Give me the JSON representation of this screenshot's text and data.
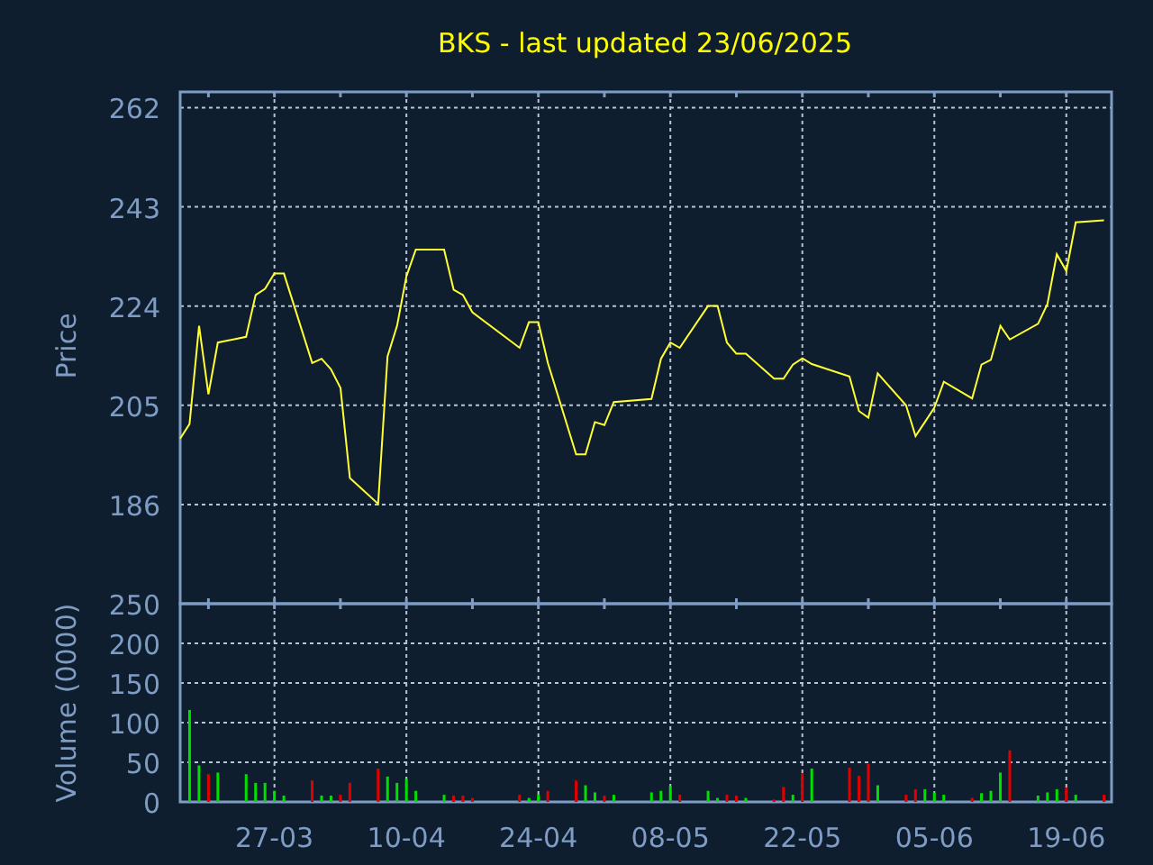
{
  "title": "BKS - last updated 23/06/2025",
  "price_panel": {
    "chart_data": {
      "type": "line",
      "ylabel": "Price",
      "categories": [
        null,
        null,
        null,
        null,
        null,
        null,
        null,
        null,
        null,
        null,
        null,
        null,
        null,
        null,
        null,
        null,
        null,
        null,
        null,
        null,
        null,
        null,
        null,
        null,
        null,
        null,
        null,
        null,
        null,
        null,
        null,
        null,
        null,
        null,
        null,
        null,
        null,
        null,
        null,
        null,
        null,
        null,
        null,
        null,
        null,
        null,
        null,
        null,
        null,
        null,
        null,
        null,
        null,
        null,
        null,
        null,
        null,
        null,
        null,
        null,
        null,
        null,
        null,
        null,
        null,
        null,
        null,
        null,
        null,
        null,
        null,
        null,
        null,
        null,
        null,
        null,
        null,
        null,
        null,
        null,
        null,
        null,
        null,
        null,
        null,
        null,
        null,
        null,
        null,
        null,
        null,
        null,
        null,
        null,
        null,
        null,
        null,
        null,
        null
      ],
      "series": [
        {
          "color": "#ffff33",
          "values": [
            198.6,
            201.4,
            220.2,
            207.1,
            217.0,
            null,
            null,
            218.1,
            226.1,
            227.3,
            230.2,
            230.2,
            null,
            null,
            213.1,
            213.9,
            211.9,
            208.3,
            191.1,
            null,
            null,
            186.1,
            214.3,
            220.2,
            229.7,
            234.8,
            null,
            null,
            234.8,
            227.1,
            226.1,
            222.8,
            null,
            null,
            null,
            null,
            216.0,
            220.9,
            220.9,
            213.1,
            null,
            null,
            195.6,
            195.6,
            201.8,
            201.2,
            205.6,
            null,
            null,
            null,
            206.2,
            213.9,
            217.0,
            216.0,
            null,
            null,
            224.0,
            224.0,
            217.0,
            214.9,
            214.9,
            null,
            null,
            210.1,
            210.1,
            212.8,
            214.0,
            212.9,
            null,
            null,
            null,
            210.5,
            203.9,
            202.6,
            211.1,
            null,
            null,
            205.0,
            199.1,
            201.8,
            204.5,
            209.5,
            null,
            null,
            206.3,
            212.8,
            213.7,
            220.2,
            217.6,
            null,
            null,
            220.6,
            224.4,
            233.9,
            230.7,
            240.0,
            null,
            null,
            240.4
          ]
        }
      ],
      "grid": true,
      "ylim": [
        167,
        265
      ],
      "yticks": [
        186,
        205,
        224,
        243,
        262
      ]
    }
  },
  "volume_panel": {
    "chart_data": {
      "type": "bar",
      "ylabel": "Volume (0000)",
      "categories": [
        null,
        null,
        null,
        null,
        null,
        null,
        null,
        null,
        null,
        null,
        "27-03",
        null,
        null,
        null,
        null,
        null,
        null,
        null,
        null,
        null,
        null,
        null,
        null,
        null,
        "10-04",
        null,
        null,
        null,
        null,
        null,
        null,
        null,
        null,
        null,
        null,
        null,
        null,
        null,
        "24-04",
        null,
        null,
        null,
        null,
        null,
        null,
        null,
        null,
        null,
        null,
        null,
        null,
        null,
        "08-05",
        null,
        null,
        null,
        null,
        null,
        null,
        null,
        null,
        null,
        null,
        null,
        null,
        null,
        "22-05",
        null,
        null,
        null,
        null,
        null,
        null,
        null,
        null,
        null,
        null,
        null,
        null,
        null,
        "05-06",
        null,
        null,
        null,
        null,
        null,
        null,
        null,
        null,
        null,
        null,
        null,
        null,
        null,
        "19-06",
        null,
        null,
        null,
        null
      ],
      "series": [
        {
          "color": "#00e000",
          "values": [
            null,
            116,
            46,
            null,
            37,
            null,
            null,
            35,
            24,
            24,
            14,
            8,
            null,
            null,
            null,
            8,
            8,
            null,
            null,
            null,
            null,
            null,
            32,
            24,
            29,
            14,
            null,
            null,
            9,
            null,
            null,
            null,
            null,
            null,
            null,
            null,
            null,
            5,
            9,
            null,
            null,
            null,
            null,
            21,
            12,
            null,
            9,
            null,
            null,
            null,
            12,
            14,
            20,
            null,
            null,
            null,
            14,
            5,
            null,
            null,
            5,
            null,
            null,
            null,
            null,
            9,
            null,
            42,
            null,
            null,
            null,
            null,
            null,
            null,
            21,
            null,
            null,
            null,
            null,
            16,
            12,
            9,
            null,
            null,
            null,
            11,
            14,
            37,
            null,
            null,
            null,
            8,
            12,
            16,
            null,
            9,
            null,
            null,
            null
          ]
        },
        {
          "color": "#e00000",
          "values": [
            null,
            null,
            null,
            35,
            null,
            null,
            null,
            null,
            null,
            null,
            null,
            null,
            null,
            null,
            27,
            null,
            null,
            9,
            24,
            null,
            null,
            42,
            null,
            null,
            null,
            null,
            null,
            null,
            null,
            8,
            8,
            5,
            null,
            null,
            null,
            null,
            9,
            null,
            null,
            14,
            null,
            null,
            27,
            null,
            null,
            8,
            null,
            null,
            null,
            null,
            null,
            null,
            null,
            9,
            null,
            null,
            null,
            null,
            9,
            8,
            null,
            null,
            null,
            3,
            19,
            null,
            36,
            null,
            null,
            null,
            null,
            43,
            33,
            48,
            null,
            null,
            null,
            9,
            16,
            null,
            null,
            null,
            null,
            null,
            5,
            null,
            null,
            null,
            65,
            null,
            null,
            null,
            null,
            null,
            18,
            null,
            null,
            null,
            9
          ]
        }
      ],
      "grid": true,
      "ylim": [
        0,
        250
      ],
      "yticks": [
        0,
        50,
        100,
        150,
        200,
        250
      ]
    }
  }
}
